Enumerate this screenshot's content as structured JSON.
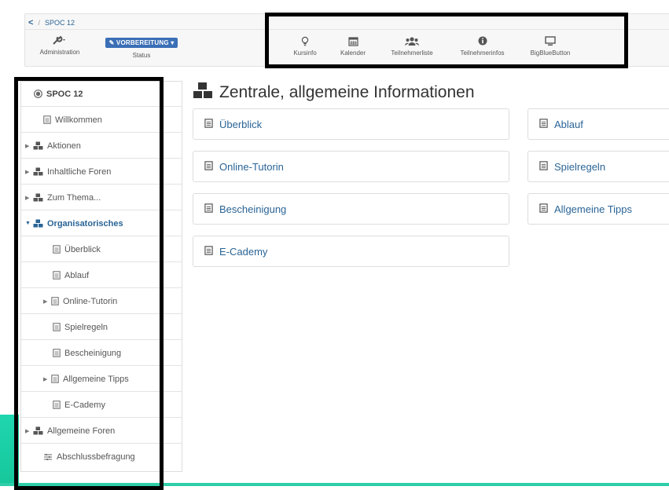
{
  "breadcrumb": {
    "back": "<",
    "separator": "/",
    "course": "SPOC 12"
  },
  "toolbar": {
    "administration_label": "Administration",
    "status_badge": "VORBEREITUNG",
    "status_label": "Status",
    "tools": [
      {
        "label": "Kursinfo",
        "icon": "lightbulb-icon"
      },
      {
        "label": "Kalender",
        "icon": "calendar-icon"
      },
      {
        "label": "Teilnehmerliste",
        "icon": "users-icon"
      },
      {
        "label": "Teilnehmerinfos",
        "icon": "info-icon"
      },
      {
        "label": "BigBlueButton",
        "icon": "monitor-icon"
      }
    ]
  },
  "sidebar": {
    "items": [
      {
        "label": "SPOC 12",
        "icon": "course-icon",
        "expander": ""
      },
      {
        "label": "Willkommen",
        "icon": "page-icon",
        "expander": ""
      },
      {
        "label": "Aktionen",
        "icon": "cubes-icon",
        "expander": "▶"
      },
      {
        "label": "Inhaltliche Foren",
        "icon": "cubes-icon",
        "expander": "▶"
      },
      {
        "label": "Zum Thema...",
        "icon": "cubes-icon",
        "expander": "▶"
      },
      {
        "label": "Organisatorisches",
        "icon": "cubes-icon",
        "expander": "▼"
      },
      {
        "label": "Überblick",
        "icon": "page-icon",
        "expander": ""
      },
      {
        "label": "Ablauf",
        "icon": "page-icon",
        "expander": ""
      },
      {
        "label": "Online-Tutorin",
        "icon": "page-icon",
        "expander": "▶"
      },
      {
        "label": "Spielregeln",
        "icon": "page-icon",
        "expander": ""
      },
      {
        "label": "Bescheinigung",
        "icon": "page-icon",
        "expander": ""
      },
      {
        "label": "Allgemeine Tipps",
        "icon": "page-icon",
        "expander": "▶"
      },
      {
        "label": "E-Cademy",
        "icon": "page-icon",
        "expander": ""
      },
      {
        "label": "Allgemeine Foren",
        "icon": "cubes-icon",
        "expander": "▶"
      },
      {
        "label": "Abschlussbefragung",
        "icon": "survey-icon",
        "expander": ""
      }
    ]
  },
  "main": {
    "title": "Zentrale, allgemeine Informationen",
    "cards": [
      {
        "label": "Überblick"
      },
      {
        "label": "Ablauf"
      },
      {
        "label": "Online-Tutorin"
      },
      {
        "label": "Spielregeln"
      },
      {
        "label": "Bescheinigung"
      },
      {
        "label": "Allgemeine Tipps"
      },
      {
        "label": "E-Cademy"
      }
    ]
  },
  "colors": {
    "link": "#2a6496",
    "status_badge": "#3b6fb6",
    "highlight_frame": "#000000",
    "teal_accent": "#1fd6b0"
  }
}
